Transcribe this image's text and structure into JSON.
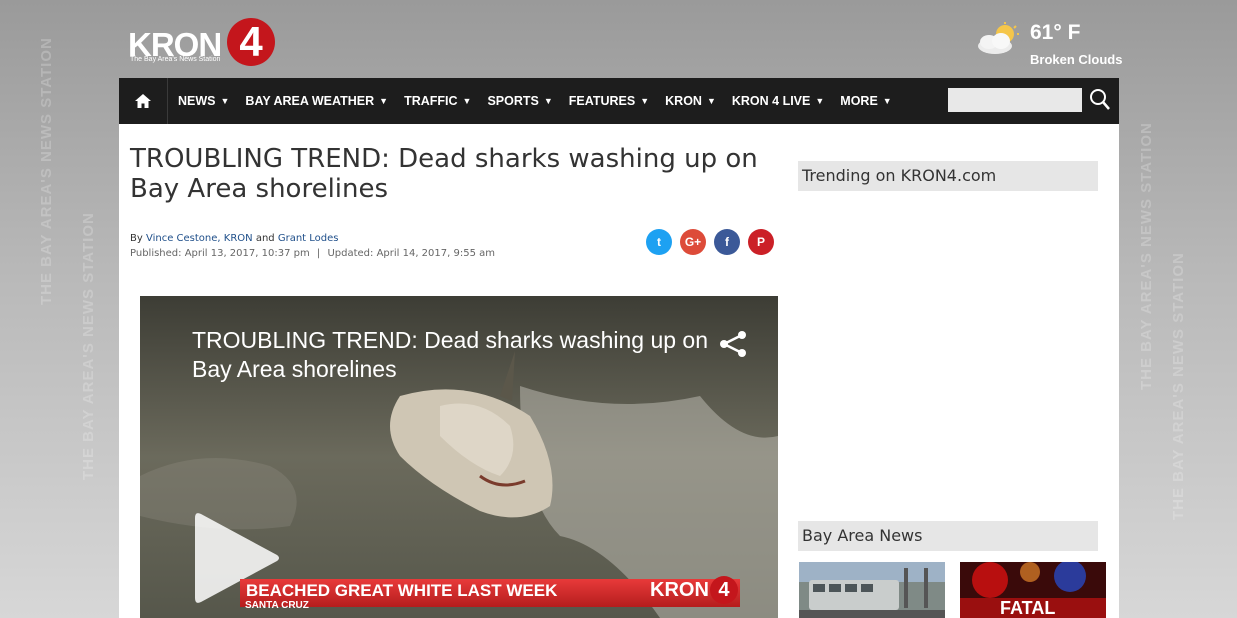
{
  "background": {
    "watermark_text": "THE BAY AREA'S NEWS STATION"
  },
  "header": {
    "logo_word": "KRON",
    "logo_number": "4",
    "logo_tagline": "The Bay Area's News Station",
    "weather": {
      "icon": "partly-cloudy-icon",
      "temperature": "61° F",
      "condition": "Broken Clouds"
    }
  },
  "nav": {
    "home_icon": "home-icon",
    "items": [
      {
        "label": "NEWS"
      },
      {
        "label": "BAY AREA WEATHER"
      },
      {
        "label": "TRAFFIC"
      },
      {
        "label": "SPORTS"
      },
      {
        "label": "FEATURES"
      },
      {
        "label": "KRON"
      },
      {
        "label": "KRON 4 LIVE"
      },
      {
        "label": "MORE"
      }
    ],
    "search_placeholder": "",
    "search_icon": "search-icon"
  },
  "article": {
    "headline": "TROUBLING TREND: Dead sharks washing up on Bay Area shorelines",
    "byline_prefix": "By",
    "author1": "Vince Cestone, KRON",
    "byline_and": "and",
    "author2": "Grant Lodes",
    "published": "Published: April 13, 2017, 10:37 pm",
    "separator": "|",
    "updated": "Updated: April 14, 2017, 9:55 am",
    "share": [
      {
        "icon": "twitter-icon",
        "glyph": "t",
        "color": "#1da1f2"
      },
      {
        "icon": "google-plus-icon",
        "glyph": "G+",
        "color": "#dd4b39"
      },
      {
        "icon": "facebook-icon",
        "glyph": "f",
        "color": "#3b5998"
      },
      {
        "icon": "pinterest-icon",
        "glyph": "P",
        "color": "#cb2027"
      }
    ]
  },
  "video": {
    "title": "TROUBLING TREND: Dead sharks washing up on Bay Area shorelines",
    "lower_third_main": "BEACHED GREAT WHITE LAST WEEK",
    "lower_third_sub": "SANTA CRUZ",
    "lower_third_logo": "KRON",
    "lower_third_logo_number": "4"
  },
  "sidebar": {
    "trending_title": "Trending on KRON4.com",
    "bay_area_title": "Bay Area News",
    "thumb2_text": "FATAL"
  }
}
